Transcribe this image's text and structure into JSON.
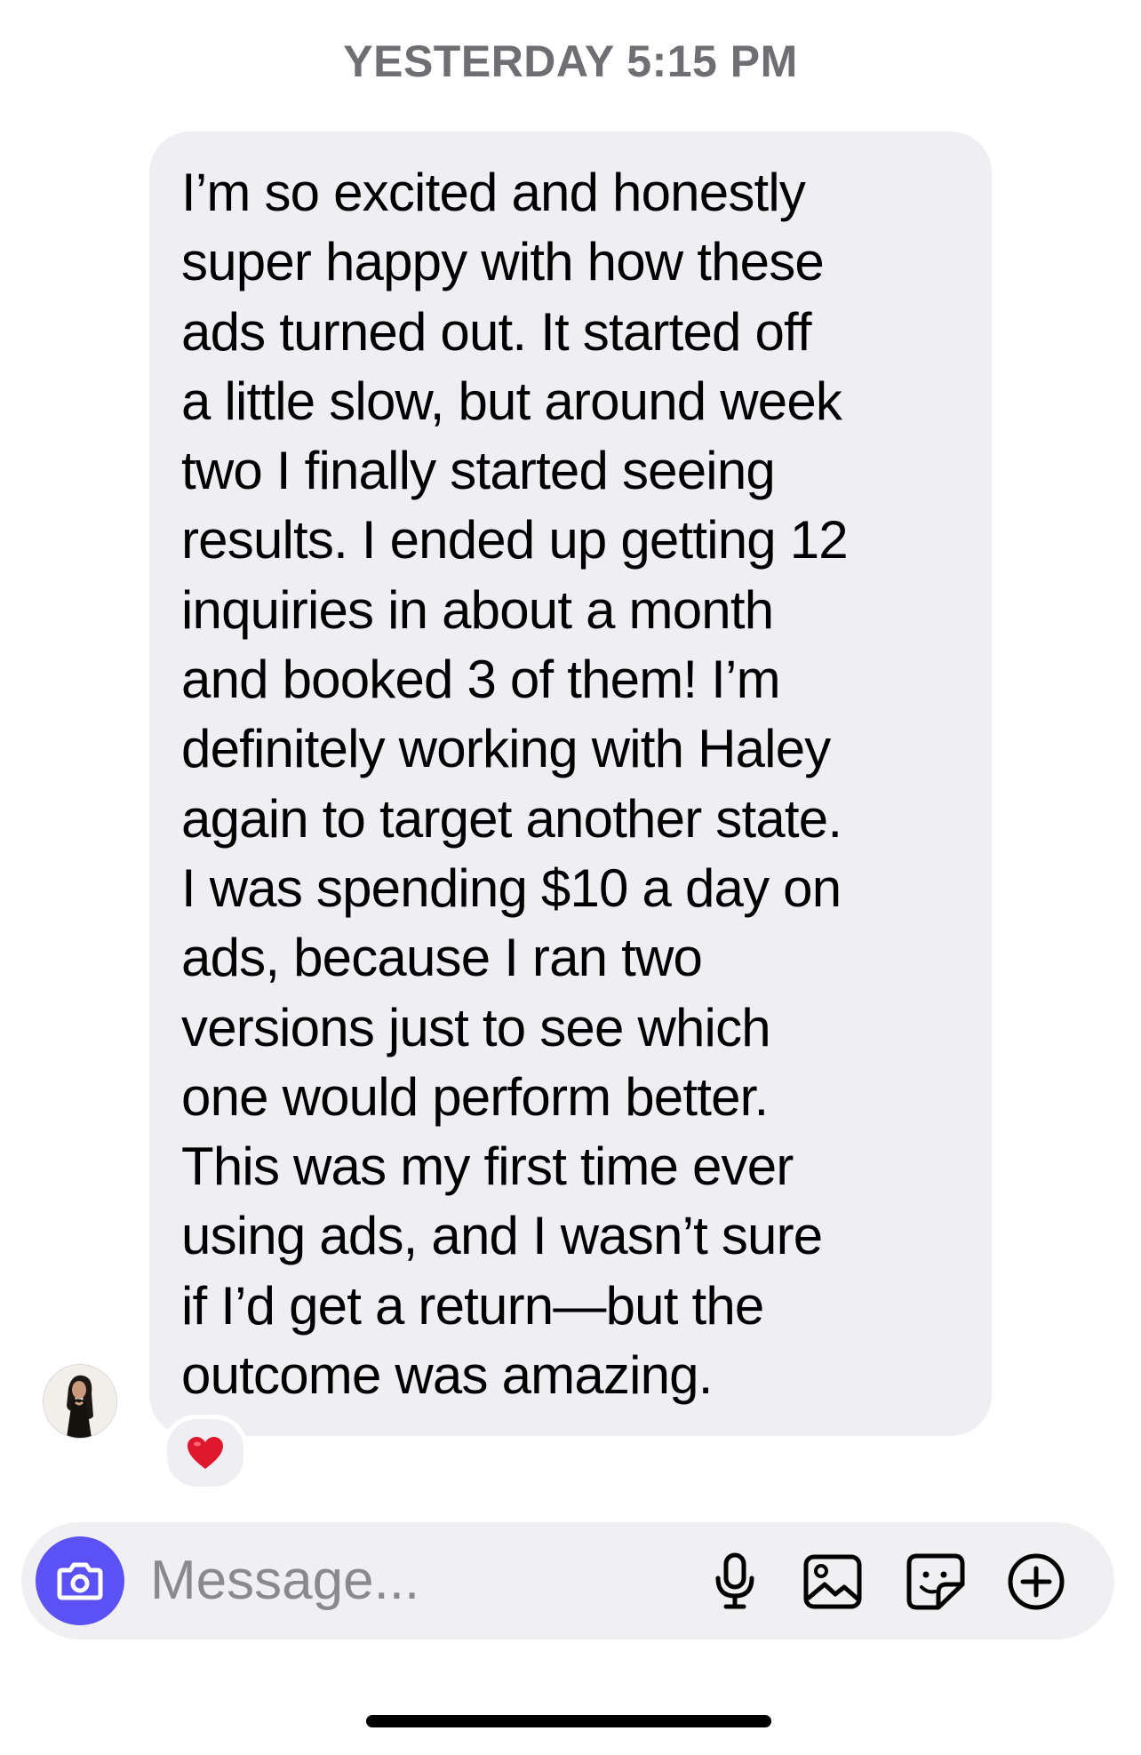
{
  "thread": {
    "timestamp": "YESTERDAY 5:15 PM"
  },
  "message": {
    "lines": [
      "I’m so excited and honestly",
      "super happy with how these",
      "ads turned out. It started off",
      "a little slow, but around week",
      "two I finally started seeing",
      "results. I ended up getting 12",
      "inquiries in about a month",
      "and booked 3 of them! I’m",
      "definitely working with Haley",
      "again to target another state.",
      "I was spending $10 a day on",
      "ads, because I ran two",
      "versions just to see which",
      "one would perform better.",
      "This was my first time ever",
      "using ads, and I wasn’t sure",
      "if I’d get a return—but the",
      "outcome was amazing."
    ],
    "reaction_icon": "red-heart-icon"
  },
  "composer": {
    "placeholder": "Message...",
    "icons": [
      "camera-icon",
      "microphone-icon",
      "gallery-icon",
      "sticker-icon",
      "plus-circle-icon"
    ]
  },
  "colors": {
    "accent": "#5b51f5",
    "bubble": "#efeff3",
    "heart": "#e0182d"
  }
}
